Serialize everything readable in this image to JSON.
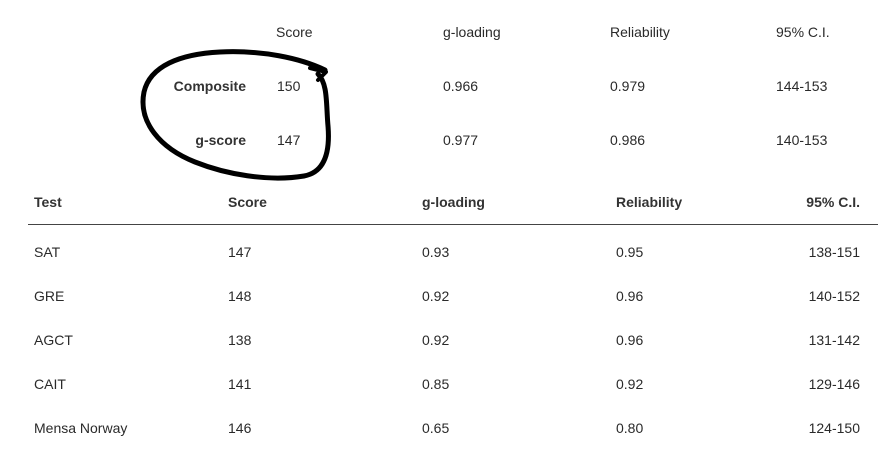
{
  "summary": {
    "headers": {
      "score": "Score",
      "g_loading": "g-loading",
      "reliability": "Reliability",
      "ci": "95% C.I."
    },
    "rows": [
      {
        "label": "Composite",
        "score": "150",
        "g_loading": "0.966",
        "reliability": "0.979",
        "ci": "144-153"
      },
      {
        "label": "g-score",
        "score": "147",
        "g_loading": "0.977",
        "reliability": "0.986",
        "ci": "140-153"
      }
    ]
  },
  "table": {
    "headers": {
      "test": "Test",
      "score": "Score",
      "g_loading": "g-loading",
      "reliability": "Reliability",
      "ci": "95% C.I."
    },
    "rows": [
      {
        "test": "SAT",
        "score": "147",
        "g_loading": "0.93",
        "reliability": "0.95",
        "ci": "138-151"
      },
      {
        "test": "GRE",
        "score": "148",
        "g_loading": "0.92",
        "reliability": "0.96",
        "ci": "140-152"
      },
      {
        "test": "AGCT",
        "score": "138",
        "g_loading": "0.92",
        "reliability": "0.96",
        "ci": "131-142"
      },
      {
        "test": "CAIT",
        "score": "141",
        "g_loading": "0.85",
        "reliability": "0.92",
        "ci": "129-146"
      },
      {
        "test": "Mensa Norway",
        "score": "146",
        "g_loading": "0.65",
        "reliability": "0.80",
        "ci": "124-150"
      }
    ]
  },
  "annotation": {
    "color": "#000000"
  }
}
